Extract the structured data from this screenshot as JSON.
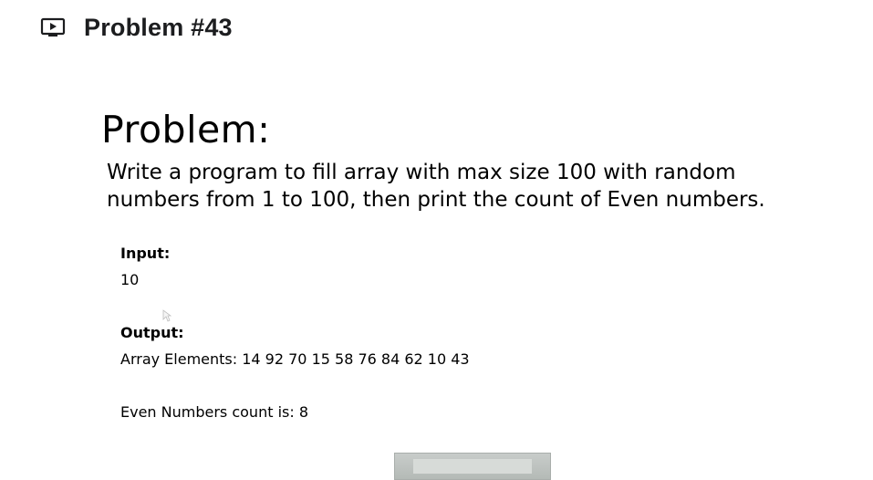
{
  "header": {
    "icon": "play-video-icon",
    "title": "Problem #43"
  },
  "slide": {
    "heading": "Problem:",
    "statement_line1": "Write a program to fill array with max size 100 with random",
    "statement_line2": "numbers from 1 to 100, then print the count of Even numbers.",
    "input_label": "Input:",
    "input_value": "10",
    "output_label": "Output:",
    "output_array": "Array Elements: 14 92 70 15 58 76 84 62 10 43",
    "output_count": "Even Numbers count is: 8"
  }
}
